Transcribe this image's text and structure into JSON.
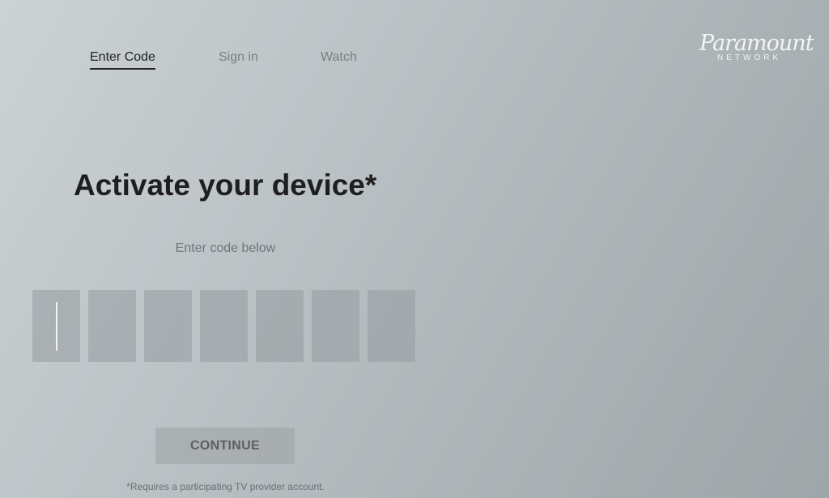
{
  "nav": {
    "items": [
      {
        "label": "Enter Code",
        "active": true
      },
      {
        "label": "Sign in",
        "active": false
      },
      {
        "label": "Watch",
        "active": false
      }
    ]
  },
  "brand": {
    "name": "Paramount",
    "sub": "NETWORK"
  },
  "main": {
    "title": "Activate your device*",
    "subtitle": "Enter code below",
    "code_length": 7,
    "code_values": [
      "",
      "",
      "",
      "",
      "",
      "",
      ""
    ],
    "continue_label": "CONTINUE",
    "footnote": "*Requires a participating TV provider account."
  },
  "colors": {
    "active_text": "#232323",
    "inactive_text": "#7a7f82",
    "logo": "#f4f5f5"
  }
}
